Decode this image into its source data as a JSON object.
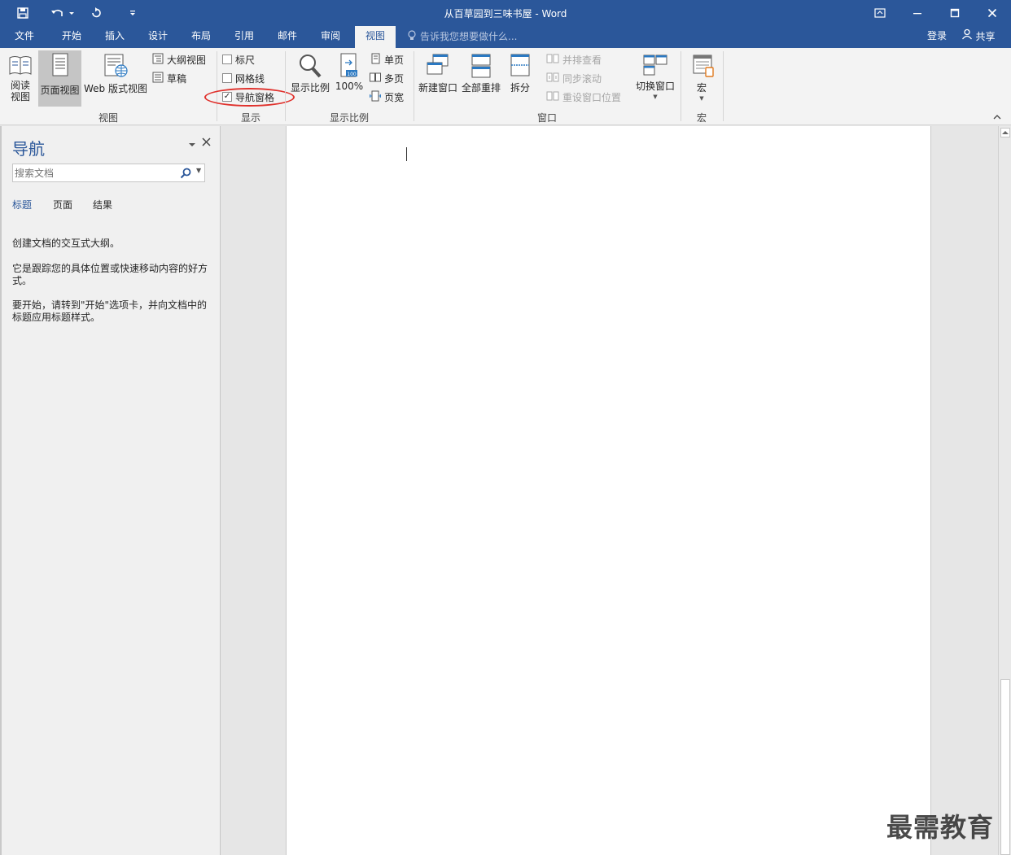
{
  "window": {
    "title": "从百草园到三味书屋 - Word"
  },
  "tabs": [
    {
      "label": "文件"
    },
    {
      "label": "开始"
    },
    {
      "label": "插入"
    },
    {
      "label": "设计"
    },
    {
      "label": "布局"
    },
    {
      "label": "引用"
    },
    {
      "label": "邮件"
    },
    {
      "label": "审阅"
    },
    {
      "label": "视图"
    }
  ],
  "tell_me": "告诉我您想要做什么...",
  "account": {
    "signin": "登录",
    "share": "共享"
  },
  "ribbon": {
    "views": {
      "label": "视图",
      "read_mode": "阅读\n视图",
      "print_layout": "页面视图",
      "web_layout": "Web 版式视图",
      "outline": "大纲视图",
      "draft": "草稿"
    },
    "show": {
      "label": "显示",
      "ruler": "标尺",
      "gridlines": "网格线",
      "nav_pane": "导航窗格"
    },
    "zoom": {
      "label": "显示比例",
      "zoom_btn": "显示比例",
      "hundred": "100%",
      "one_page": "单页",
      "multi_page": "多页",
      "page_width": "页宽"
    },
    "window": {
      "label": "窗口",
      "new_window": "新建窗口",
      "arrange_all": "全部重排",
      "split": "拆分",
      "side_by_side": "并排查看",
      "sync_scroll": "同步滚动",
      "reset_pos": "重设窗口位置",
      "switch": "切换窗口"
    },
    "macros": {
      "label": "宏",
      "btn": "宏"
    }
  },
  "nav": {
    "title": "导航",
    "search_placeholder": "搜索文档",
    "tabs": [
      "标题",
      "页面",
      "结果"
    ],
    "p1": "创建文档的交互式大纲。",
    "p2": "它是跟踪您的具体位置或快速移动内容的好方式。",
    "p3": "要开始，请转到\"开始\"选项卡，并向文档中的标题应用标题样式。"
  },
  "watermark": "最需教育",
  "colors": {
    "brand": "#2b579a",
    "annotation": "#e0312c"
  }
}
